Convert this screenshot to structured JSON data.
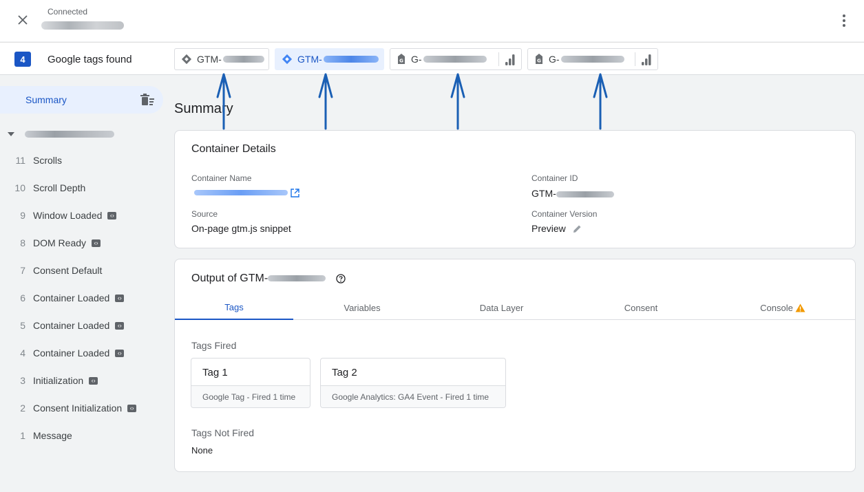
{
  "topbar": {
    "status": "Connected",
    "close_icon": "close-icon",
    "menu_icon": "more-vert-icon"
  },
  "tagsbar": {
    "count": "4",
    "label": "Google tags found",
    "chips": [
      {
        "prefix": "GTM-",
        "kind": "gtm",
        "active": false
      },
      {
        "prefix": "GTM-",
        "kind": "gtm",
        "active": true
      },
      {
        "prefix": "G-",
        "kind": "ga4",
        "active": false
      },
      {
        "prefix": "G-",
        "kind": "ga4",
        "active": false
      }
    ]
  },
  "sidebar": {
    "summary": "Summary",
    "events": [
      {
        "num": "11",
        "name": "Scrolls",
        "code": false
      },
      {
        "num": "10",
        "name": "Scroll Depth",
        "code": false
      },
      {
        "num": "9",
        "name": "Window Loaded",
        "code": true
      },
      {
        "num": "8",
        "name": "DOM Ready",
        "code": true
      },
      {
        "num": "7",
        "name": "Consent Default",
        "code": false
      },
      {
        "num": "6",
        "name": "Container Loaded",
        "code": true
      },
      {
        "num": "5",
        "name": "Container Loaded",
        "code": true
      },
      {
        "num": "4",
        "name": "Container Loaded",
        "code": true
      },
      {
        "num": "3",
        "name": "Initialization",
        "code": true
      },
      {
        "num": "2",
        "name": "Consent Initialization",
        "code": true
      },
      {
        "num": "1",
        "name": "Message",
        "code": false
      }
    ]
  },
  "main": {
    "title": "Summary",
    "details": {
      "title": "Container Details",
      "name_label": "Container Name",
      "id_label": "Container ID",
      "id_prefix": "GTM-",
      "source_label": "Source",
      "source_value": "On-page gtm.js snippet",
      "version_label": "Container Version",
      "version_value": "Preview"
    },
    "output": {
      "title_prefix": "Output of GTM-",
      "tabs": [
        "Tags",
        "Variables",
        "Data Layer",
        "Consent",
        "Console"
      ],
      "fired_label": "Tags Fired",
      "fired": [
        {
          "name": "Tag 1",
          "detail": "Google Tag - Fired 1 time"
        },
        {
          "name": "Tag 2",
          "detail": "Google Analytics: GA4 Event - Fired 1 time"
        }
      ],
      "not_fired_label": "Tags Not Fired",
      "not_fired_value": "None"
    }
  },
  "colors": {
    "accent": "#1a56c5",
    "annotation_arrow": "#1a5fb4",
    "warning": "#f29900"
  }
}
